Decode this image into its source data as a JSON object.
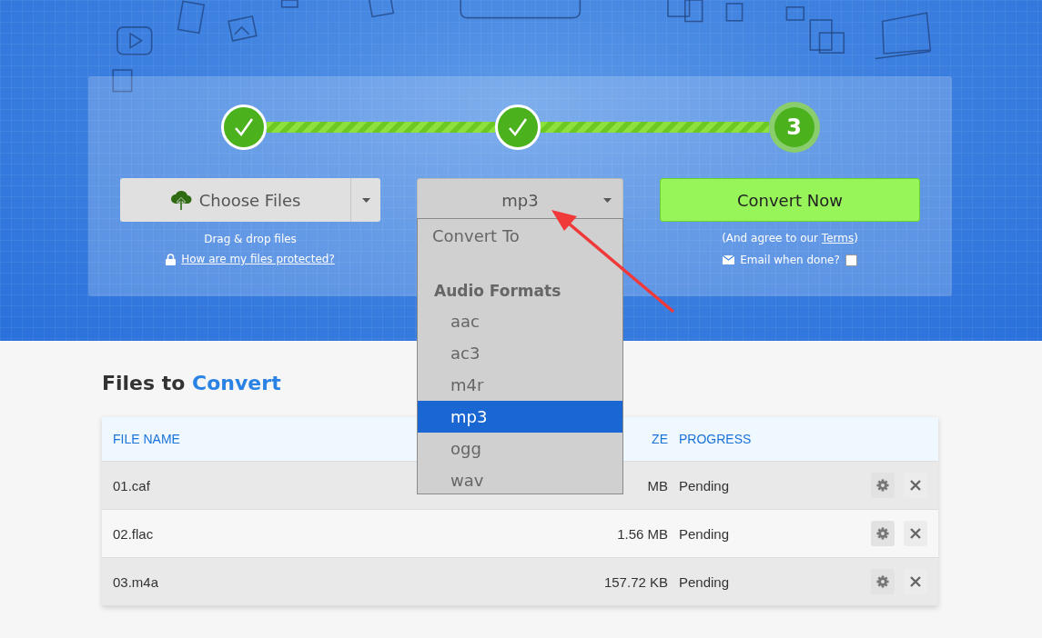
{
  "steps": [
    {
      "done": true
    },
    {
      "done": true
    },
    {
      "done": false,
      "label": "3"
    }
  ],
  "choose_button": {
    "label": "Choose Files"
  },
  "drop_hint": "Drag & drop files",
  "protect_link": "How are my files protected?",
  "format_select": {
    "value": "mp3",
    "expanded": true
  },
  "format_menu": {
    "header": "Convert To",
    "group": "Audio Formats",
    "options": [
      {
        "label": "aac",
        "selected": false
      },
      {
        "label": "ac3",
        "selected": false
      },
      {
        "label": "m4r",
        "selected": false
      },
      {
        "label": "mp3",
        "selected": true
      },
      {
        "label": "ogg",
        "selected": false
      },
      {
        "label": "wav",
        "selected": false
      }
    ]
  },
  "convert_button": {
    "label": "Convert Now"
  },
  "agree_text": {
    "before": "(And agree to our ",
    "link": "Terms",
    "after": ")"
  },
  "email_option": {
    "label": "Email when done?",
    "checked": false
  },
  "files_heading": {
    "plain": "Files to",
    "accent": "Convert"
  },
  "table": {
    "columns": [
      "FILE NAME",
      "ZE",
      "PROGRESS"
    ],
    "rows": [
      {
        "name": "01.caf",
        "size": "MB",
        "progress": "Pending"
      },
      {
        "name": "02.flac",
        "size": "1.56 MB",
        "progress": "Pending"
      },
      {
        "name": "03.m4a",
        "size": "157.72 KB",
        "progress": "Pending"
      }
    ]
  }
}
